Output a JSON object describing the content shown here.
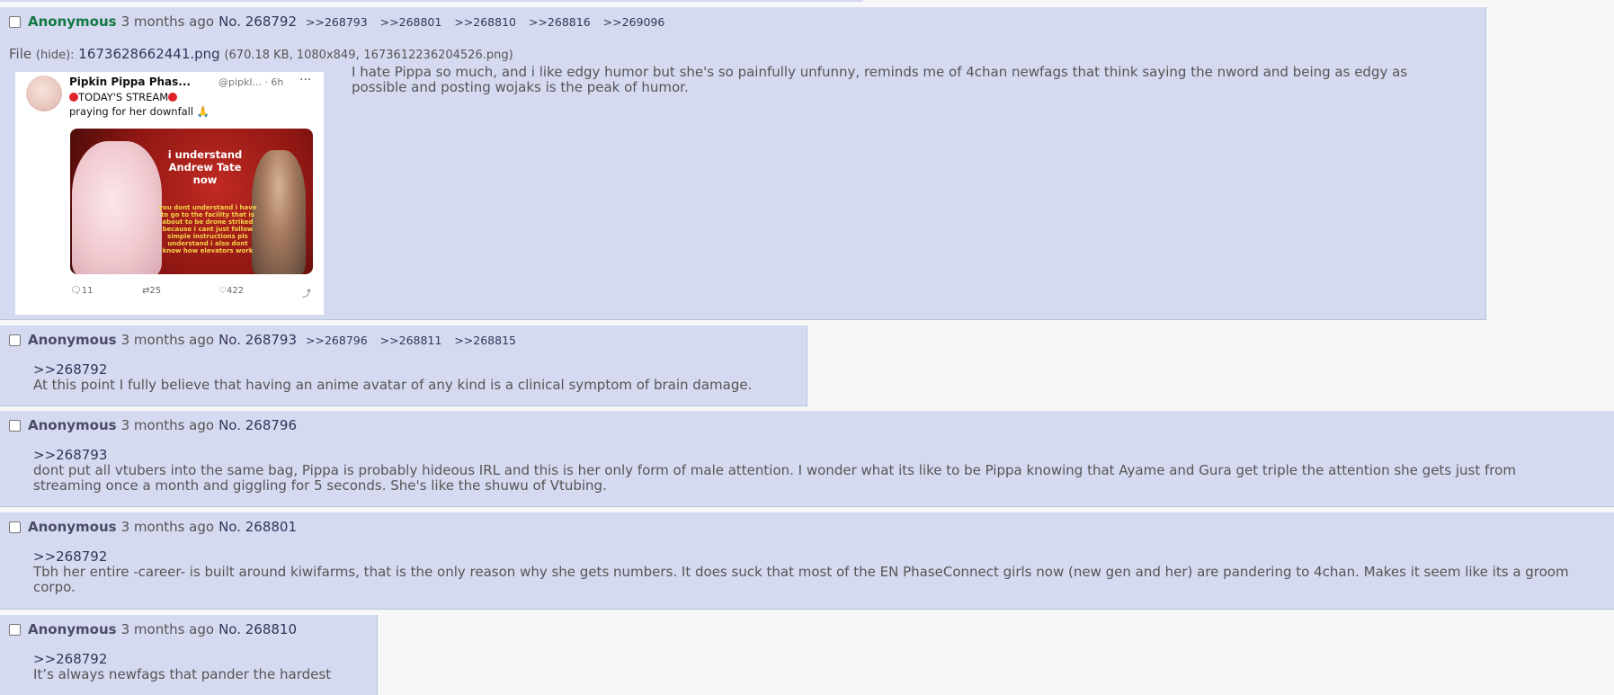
{
  "posts": [
    {
      "name": "Anonymous",
      "date": "3 months ago",
      "number": "No. 268792",
      "backlinks": [
        ">>268793",
        ">>268801",
        ">>268810",
        ">>268816",
        ">>269096"
      ],
      "file": {
        "label": "File",
        "hide": "(hide):",
        "filename": "1673628662441.png",
        "meta": "(670.18 KB, 1080x849,",
        "original": "1673612236204526.png)"
      },
      "thumbnail": {
        "author": "Pipkin Pippa",
        "author_suffix": "Phas...",
        "handle": "@pipkl... · 6h",
        "more": "···",
        "line2": "TODAY'S STREAM",
        "line3": "praying for her downfall 🙏",
        "caption_main": "i understand Andrew Tate now",
        "caption_sub": "you dont understand i have to go to the facility that is about to be drone striked because i cant just follow simple instructions pls understand i also dont know how elevators work",
        "replies": "11",
        "retweets": "25",
        "likes": "422"
      },
      "text": "I hate Pippa so much, and i like edgy humor but she's so painfully unfunny, reminds me of 4chan newfags that think saying the nword and being as edgy as possible and posting wojaks is the peak of humor."
    },
    {
      "name": "Anonymous",
      "date": "3 months ago",
      "number": "No. 268793",
      "backlinks": [
        ">>268796",
        ">>268811",
        ">>268815"
      ],
      "quote": ">>268792",
      "text": "At this point I fully believe that having an  anime avatar of any kind is a clinical symptom of brain damage."
    },
    {
      "name": "Anonymous",
      "date": "3 months ago",
      "number": "No. 268796",
      "backlinks": [],
      "quote": ">>268793",
      "text": "dont put all vtubers into the same bag, Pippa is probably hideous IRL and this is her only form of male attention. I wonder what its like to be Pippa knowing that Ayame and Gura get triple the attention she gets just from streaming once a month and giggling for 5 seconds. She's like the shuwu of Vtubing."
    },
    {
      "name": "Anonymous",
      "date": "3 months ago",
      "number": "No. 268801",
      "backlinks": [],
      "quote": ">>268792",
      "text": "Tbh her entire -career- is built around kiwifarms, that is the only reason why she gets numbers. It does suck that most of the EN PhaseConnect girls now (new gen and her) are pandering to 4chan. Makes it seem like its a groom corpo."
    },
    {
      "name": "Anonymous",
      "date": "3 months ago",
      "number": "No. 268810",
      "backlinks": [],
      "quote": ">>268792",
      "text": "It’s always newfags that pander the hardest"
    }
  ]
}
